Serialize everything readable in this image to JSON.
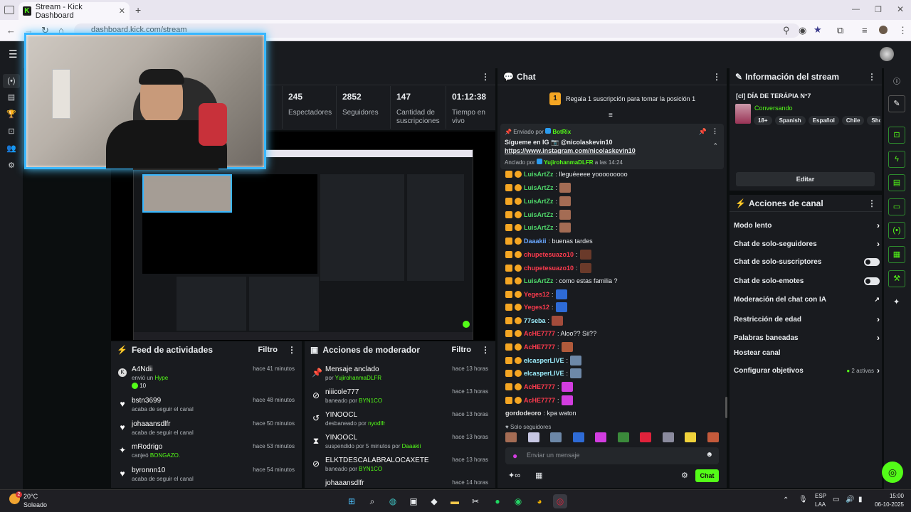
{
  "browser": {
    "tab_title": "Stream - Kick Dashboard",
    "url": "dashboard.kick.com/stream",
    "new_tab": "+"
  },
  "stats": [
    {
      "value": "245",
      "label": "Espectadores"
    },
    {
      "value": "2852",
      "label": "Seguidores"
    },
    {
      "value": "147",
      "label": "Cantidad de suscripciones"
    },
    {
      "value": "01:12:38",
      "label": "Tiempo en vivo"
    }
  ],
  "activity": {
    "title": "Feed de actividades",
    "filter": "Filtro",
    "items": [
      {
        "icon": "kick-icon",
        "name": "A4Ndii",
        "sub": "envió un",
        "sub_highlight": "Hype",
        "extra": "10",
        "time": "hace 41 minutos"
      },
      {
        "icon": "heart-icon",
        "name": "bstn3699",
        "sub": "acaba de seguir el canal",
        "sub_highlight": "",
        "extra": "",
        "time": "hace 48 minutos"
      },
      {
        "icon": "heart-icon",
        "name": "johaaansdlfr",
        "sub": "acaba de seguir el canal",
        "sub_highlight": "",
        "extra": "",
        "time": "hace 50 minutos"
      },
      {
        "icon": "redeem-icon",
        "name": "mRodrigo",
        "sub": "canjeó",
        "sub_highlight": "BONGAZO.",
        "extra": "",
        "time": "hace 53 minutos"
      },
      {
        "icon": "heart-icon",
        "name": "byronnn10",
        "sub": "acaba de seguir el canal",
        "sub_highlight": "",
        "extra": "",
        "time": "hace 54 minutos"
      }
    ]
  },
  "modactions": {
    "title": "Acciones de moderador",
    "filter": "Filtro",
    "items": [
      {
        "icon": "pin-icon",
        "name": "Mensaje anclado",
        "by": "por",
        "who": "YujirohanmaDLFR",
        "time": "hace 13 horas"
      },
      {
        "icon": "ban-icon",
        "name": "niiicole777",
        "by": "baneado por",
        "who": "BYN1CO",
        "time": "hace 13 horas"
      },
      {
        "icon": "unban-icon",
        "name": "YINOOCL",
        "by": "desbaneado por",
        "who": "nyodlfr",
        "time": "hace 13 horas"
      },
      {
        "icon": "timeout-icon",
        "name": "YINOOCL",
        "by": "suspendido por 5 minutos por",
        "who": "Daaakii",
        "time": "hace 13 horas"
      },
      {
        "icon": "ban-icon",
        "name": "ELKTDESCALABRALOCAXETE",
        "by": "baneado por",
        "who": "BYN1CO",
        "time": "hace 13 horas"
      },
      {
        "icon": "ban-icon",
        "name": "johaaansdlfr",
        "by": "",
        "who": "",
        "time": "hace 14 horas"
      }
    ]
  },
  "chat": {
    "title": "Chat",
    "goal": "Regala 1 suscripción para tomar la posición 1",
    "goal_rank": "1",
    "pinned": {
      "sent_by": "Enviado por",
      "bot": "BotRix",
      "line1": "Sígueme en IG 📷 @nicolaskevin10",
      "line2": "https://www.instagram.com/nicolaskevin10",
      "anchored_by": "Anclado por",
      "anchor_user": "YujirohanmaDLFR",
      "anchor_time": "a las 14:24"
    },
    "messages": [
      {
        "user": "LuisArtZz",
        "color": "#4fd66a",
        "text": ": lleguéeeee yooooooooo",
        "emote": false
      },
      {
        "user": "LuisArtZz",
        "color": "#4fd66a",
        "text": ":",
        "emote": true
      },
      {
        "user": "LuisArtZz",
        "color": "#4fd66a",
        "text": ":",
        "emote": true
      },
      {
        "user": "LuisArtZz",
        "color": "#4fd66a",
        "text": ":",
        "emote": true
      },
      {
        "user": "LuisArtZz",
        "color": "#4fd66a",
        "text": ":",
        "emote": true
      },
      {
        "user": "Daaakii",
        "color": "#6aa7ff",
        "text": ": buenas tardes",
        "emote": false
      },
      {
        "user": "chupetesuazo10",
        "color": "#ff3b4e",
        "text": ":",
        "emote": true
      },
      {
        "user": "chupetesuazo10",
        "color": "#ff3b4e",
        "text": ":",
        "emote": true
      },
      {
        "user": "LuisArtZz",
        "color": "#4fd66a",
        "text": ": como estas familia ?",
        "emote": false
      },
      {
        "user": "Yeges12",
        "color": "#ff3b4e",
        "text": ":",
        "emote": true
      },
      {
        "user": "Yeges12",
        "color": "#ff3b4e",
        "text": ":",
        "emote": true
      },
      {
        "user": "77seba",
        "color": "#9ef0ff",
        "text": ":",
        "emote": true
      },
      {
        "user": "AcHE7777",
        "color": "#ff3b4e",
        "text": ": Aloo?? Sii??",
        "emote": false
      },
      {
        "user": "AcHE7777",
        "color": "#ff3b4e",
        "text": ":",
        "emote": true
      },
      {
        "user": "elcasperLIVE",
        "color": "#9ef0ff",
        "text": ":",
        "emote": true
      },
      {
        "user": "elcasperLIVE",
        "color": "#9ef0ff",
        "text": ":",
        "emote": true
      },
      {
        "user": "AcHE7777",
        "color": "#ff3b4e",
        "text": ":",
        "emote": true
      },
      {
        "user": "AcHE7777",
        "color": "#ff3b4e",
        "text": ":",
        "emote": true
      },
      {
        "user": "gordodeoro",
        "color": "#e0e0e0",
        "text": ": kpa waton",
        "emote": false
      }
    ],
    "followers_only": "Solo seguidores",
    "placeholder": "Enviar un mensaje",
    "send": "Chat"
  },
  "info": {
    "title": "Información del stream",
    "stream_title": "[cl] DÍA DE TERÁPIA N°7",
    "category": "Conversando",
    "tags": [
      "18+",
      "Spanish",
      "Español",
      "Chile",
      "Shooter"
    ],
    "edit": "Editar"
  },
  "channel": {
    "title": "Acciones de canal",
    "items": [
      {
        "label": "Modo lento",
        "ctrl": "chevron"
      },
      {
        "label": "Chat de solo-seguidores",
        "ctrl": "chevron"
      },
      {
        "label": "Chat de solo-suscriptores",
        "ctrl": "toggle"
      },
      {
        "label": "Chat de solo-emotes",
        "ctrl": "toggle"
      },
      {
        "label": "Moderación del chat con IA",
        "ctrl": "external"
      },
      {
        "label": "Restricción de edad",
        "ctrl": "chevron"
      },
      {
        "label": "Palabras baneadas",
        "ctrl": "chevron"
      },
      {
        "label": "Hostear canal",
        "ctrl": "none"
      },
      {
        "label": "Configurar objetivos",
        "ctrl": "goals"
      }
    ],
    "goals": "2 activas"
  },
  "taskbar": {
    "temp": "20°C",
    "weather": "Soleado",
    "lang": "ESP",
    "region": "LAA",
    "time": "15:00",
    "date": "06-10-2025",
    "notif": "2"
  }
}
